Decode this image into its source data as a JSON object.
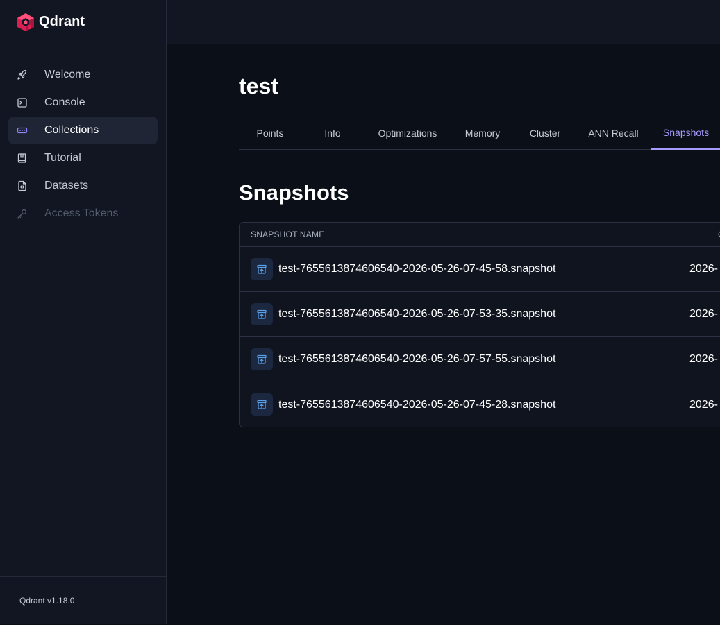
{
  "brand": {
    "name": "Qdrant",
    "accent": "#e0245e"
  },
  "sidebar": {
    "items": [
      {
        "label": "Welcome",
        "icon": "rocket-icon",
        "state": "normal"
      },
      {
        "label": "Console",
        "icon": "terminal-icon",
        "state": "normal"
      },
      {
        "label": "Collections",
        "icon": "collections-icon",
        "state": "active"
      },
      {
        "label": "Tutorial",
        "icon": "book-icon",
        "state": "normal"
      },
      {
        "label": "Datasets",
        "icon": "file-code-icon",
        "state": "normal"
      },
      {
        "label": "Access Tokens",
        "icon": "key-icon",
        "state": "disabled"
      }
    ],
    "footer": "Qdrant v1.18.0"
  },
  "main": {
    "title": "test",
    "tabs": [
      {
        "label": "Points",
        "active": false
      },
      {
        "label": "Info",
        "active": false
      },
      {
        "label": "Optimizations",
        "active": false
      },
      {
        "label": "Memory",
        "active": false
      },
      {
        "label": "Cluster",
        "active": false
      },
      {
        "label": "ANN Recall",
        "active": false
      },
      {
        "label": "Snapshots",
        "active": true
      }
    ],
    "section_title": "Snapshots",
    "table": {
      "headers": {
        "name": "SNAPSHOT NAME",
        "created": "C"
      },
      "rows": [
        {
          "name": "test-7655613874606540-2026-05-26-07-45-58.snapshot",
          "created": "2026-"
        },
        {
          "name": "test-7655613874606540-2026-05-26-07-53-35.snapshot",
          "created": "2026-"
        },
        {
          "name": "test-7655613874606540-2026-05-26-07-57-55.snapshot",
          "created": "2026-"
        },
        {
          "name": "test-7655613874606540-2026-05-26-07-45-28.snapshot",
          "created": "2026-"
        }
      ],
      "row_icon": "archive-upload-icon"
    }
  },
  "colors": {
    "tab_active": "#a89bff",
    "row_icon": "#5aa0e6"
  }
}
